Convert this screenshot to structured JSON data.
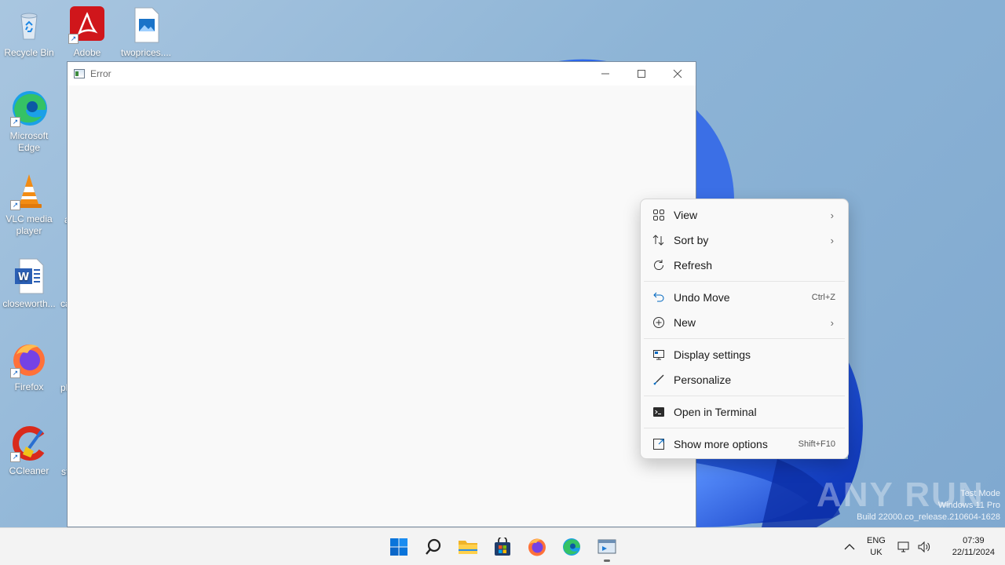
{
  "desktop": {
    "icons": [
      {
        "name": "recycle-bin",
        "label": "Recycle Bin"
      },
      {
        "name": "adobe-acrobat",
        "label": "Adobe Acrobat"
      },
      {
        "name": "twoprices-file",
        "label": "twoprices...."
      },
      {
        "name": "microsoft-edge",
        "label": "Microsoft Edge"
      },
      {
        "name": "vlc-media-player",
        "label": "VLC media player"
      },
      {
        "name": "closeworth-doc",
        "label": "closeworth..."
      },
      {
        "name": "firefox",
        "label": "Firefox"
      },
      {
        "name": "ccleaner",
        "label": "CCleaner"
      }
    ],
    "clipped_labels": [
      "a",
      "ca",
      "pl",
      "st"
    ]
  },
  "window": {
    "title": "Error",
    "controls": {
      "minimize": "—",
      "maximize": "☐",
      "close": "✕"
    }
  },
  "context_menu": {
    "items": [
      {
        "label": "View",
        "icon": "grid-view-icon",
        "submenu": true
      },
      {
        "label": "Sort by",
        "icon": "sort-icon",
        "submenu": true
      },
      {
        "label": "Refresh",
        "icon": "refresh-icon"
      },
      {
        "label": "Undo Move",
        "icon": "undo-icon",
        "shortcut": "Ctrl+Z"
      },
      {
        "label": "New",
        "icon": "new-plus-icon",
        "submenu": true
      },
      {
        "label": "Display settings",
        "icon": "display-icon"
      },
      {
        "label": "Personalize",
        "icon": "brush-icon"
      },
      {
        "label": "Open in Terminal",
        "icon": "terminal-icon"
      },
      {
        "label": "Show more options",
        "icon": "more-options-icon",
        "shortcut": "Shift+F10"
      }
    ]
  },
  "taskbar": {
    "apps": [
      "start-icon",
      "search-icon",
      "file-explorer-icon",
      "store-icon",
      "firefox-icon",
      "edge-icon",
      "active-app-icon"
    ],
    "tray": {
      "lang_top": "ENG",
      "lang_bottom": "UK",
      "time": "07:39",
      "date": "22/11/2024"
    }
  },
  "watermark": {
    "line1": "Test Mode",
    "line2": "Windows 11 Pro",
    "line3": "Build 22000.co_release.210604-1628",
    "brand": "ANY RUN"
  },
  "colors": {
    "accent": "#0067c0",
    "wallpaper": "#8db4d6",
    "bloom": "#1a4fd8"
  }
}
